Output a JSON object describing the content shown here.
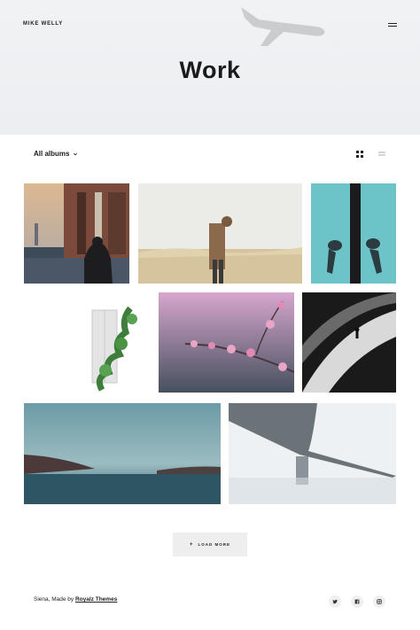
{
  "brand": {
    "name": "MIKE WELLY"
  },
  "header": {
    "title": "Work",
    "menu_icon": "hamburger-icon"
  },
  "toolbar": {
    "filter_label": "All albums",
    "filter_icon": "chevron-down-icon",
    "view_grid_icon": "grid-view-icon",
    "view_list_icon": "list-view-icon"
  },
  "gallery": {
    "images": [
      {
        "subject": "city-street-woman-photo"
      },
      {
        "subject": "field-person-photo"
      },
      {
        "subject": "wall-figures-photo"
      },
      {
        "subject": "window-ivy-photo"
      },
      {
        "subject": "pink-blossom-photo"
      },
      {
        "subject": "stairs-person-photo"
      },
      {
        "subject": "misty-lake-photo"
      },
      {
        "subject": "bridge-photo"
      }
    ]
  },
  "load_more": {
    "label": "LOAD MORE",
    "icon": "+"
  },
  "footer": {
    "text": "Siena, Made by ",
    "link": "Royalz Themes",
    "social": [
      "twitter-icon",
      "facebook-icon",
      "instagram-icon"
    ]
  },
  "colors": {
    "hero_bg": "#eef0f3",
    "text": "#1b1b1b",
    "button_bg": "#eeeeee",
    "social_bg": "#f0f0f0"
  }
}
